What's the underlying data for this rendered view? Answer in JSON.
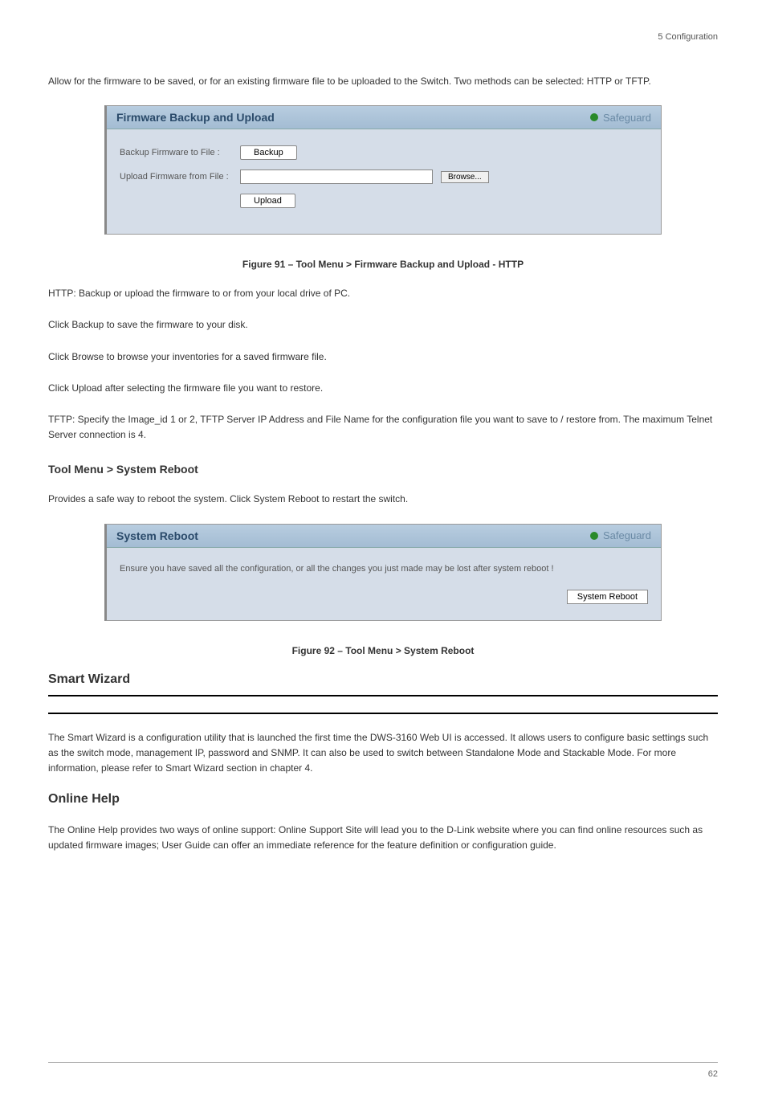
{
  "header_line": "5 Configuration",
  "intro1": "Allow for the firmware to be saved, or for an existing firmware file to be uploaded to the Switch. Two methods can be selected: HTTP or TFTP.",
  "figure1_caption": "Figure 91 – Tool Menu > Firmware Backup and Upload - HTTP",
  "firmware_panel": {
    "title": "Firmware Backup and Upload",
    "safeguard": "Safeguard",
    "backup_label": "Backup Firmware to File :",
    "backup_btn": "Backup",
    "upload_label": "Upload Firmware from File :",
    "browse_btn": "Browse...",
    "upload_btn": "Upload"
  },
  "http_text": "HTTP: Backup or upload the firmware to or from your local drive of PC.",
  "http_backup": "Click Backup to save the firmware to your disk.",
  "http_browse": "Click Browse to browse your inventories for a saved firmware file.",
  "http_upload": "Click Upload after selecting the firmware file you want to restore.",
  "tftp_text": "TFTP: Specify the Image_id 1 or 2, TFTP Server IP Address and File Name for the configuration file you want to save to / restore from. The maximum Telnet Server connection is 4.",
  "tool_reboot_title": "Tool Menu > System Reboot",
  "tool_reboot_text": "Provides a safe way to reboot the system. Click System Reboot to restart the switch.",
  "figure2_caption": "Figure 92 – Tool Menu > System Reboot",
  "reboot_panel": {
    "title": "System Reboot",
    "safeguard": "Safeguard",
    "warning": "Ensure you have saved all the configuration, or all the changes you just made may be lost after system reboot !",
    "reboot_btn": "System Reboot"
  },
  "smart_wizard_title": "Smart Wizard",
  "hr_after_title": true,
  "smart_wizard_text": "The Smart Wizard is a configuration utility that is launched the first time the DWS-3160 Web UI is accessed. It allows users to configure basic settings such as the switch mode, management IP, password and SNMP. It can also be used to switch between Standalone Mode and Stackable Mode. For more information, please refer to Smart Wizard section in chapter 4.",
  "online_help_title": "Online Help",
  "online_help_text": "The Online Help provides two ways of online support: Online Support Site will lead you to the D-Link website where you can find online resources such as updated firmware images; User Guide can offer an immediate reference for the feature definition or configuration guide.",
  "footer": "62"
}
